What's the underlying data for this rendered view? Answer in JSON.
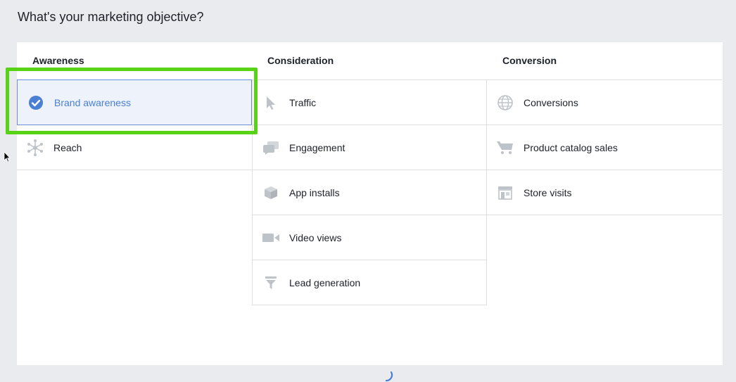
{
  "page": {
    "title": "What's your marketing objective?"
  },
  "columns": [
    {
      "header": "Awareness",
      "items": [
        {
          "label": "Brand awareness",
          "icon": "check-circle-icon",
          "selected": true
        },
        {
          "label": "Reach",
          "icon": "reach-network-icon",
          "selected": false
        }
      ]
    },
    {
      "header": "Consideration",
      "items": [
        {
          "label": "Traffic",
          "icon": "cursor-arrow-icon",
          "selected": false
        },
        {
          "label": "Engagement",
          "icon": "chat-bubbles-icon",
          "selected": false
        },
        {
          "label": "App installs",
          "icon": "box-icon",
          "selected": false
        },
        {
          "label": "Video views",
          "icon": "video-camera-icon",
          "selected": false
        },
        {
          "label": "Lead generation",
          "icon": "funnel-icon",
          "selected": false
        }
      ]
    },
    {
      "header": "Conversion",
      "items": [
        {
          "label": "Conversions",
          "icon": "globe-icon",
          "selected": false
        },
        {
          "label": "Product catalog sales",
          "icon": "shopping-cart-icon",
          "selected": false
        },
        {
          "label": "Store visits",
          "icon": "storefront-icon",
          "selected": false
        }
      ]
    }
  ],
  "colors": {
    "selected_text": "#4b7fd6",
    "selected_bg": "#edf2fb",
    "highlight_border": "#57d214",
    "icon_gray": "#bec3c9"
  }
}
